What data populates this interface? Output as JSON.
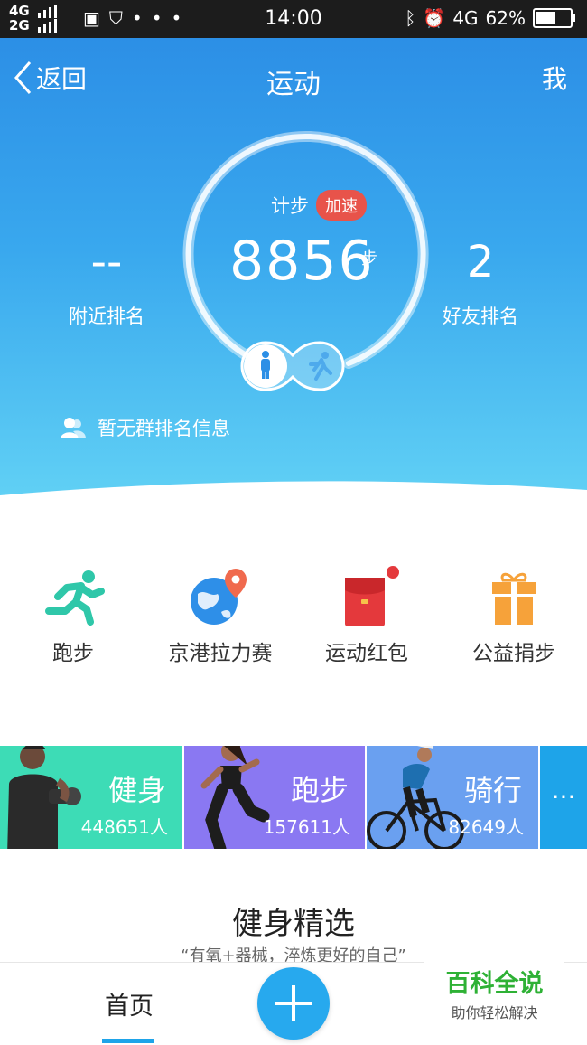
{
  "status_bar": {
    "network_top": "4G",
    "network_bottom": "2G",
    "time": "14:00",
    "network_right": "4G",
    "battery": "62%",
    "battery_level": 0.62
  },
  "nav": {
    "back_label": "返回",
    "title": "运动",
    "me_label": "我"
  },
  "stats": {
    "step_label": "计步",
    "accelerate_badge": "加速",
    "step_count": "8856",
    "step_unit": "步",
    "nearby_value": "--",
    "nearby_label": "附近排名",
    "friend_value": "2",
    "friend_label": "好友排名",
    "group_info": "暂无群排名信息"
  },
  "shortcuts": [
    {
      "label": "跑步",
      "icon": "running-icon"
    },
    {
      "label": "京港拉力赛",
      "icon": "globe-pin-icon"
    },
    {
      "label": "运动红包",
      "icon": "red-envelope-icon"
    },
    {
      "label": "公益捐步",
      "icon": "gift-icon"
    }
  ],
  "categories": [
    {
      "name": "健身",
      "count": "448651人",
      "color": "#3ddcb6"
    },
    {
      "name": "跑步",
      "count": "157611人",
      "color": "#8a78f2"
    },
    {
      "name": "骑行",
      "count": "82649人",
      "color": "#6aa0f0"
    }
  ],
  "more_label": "···",
  "section": {
    "title": "健身精选",
    "subtitle": "“有氧+器械，淬炼更好的自己”"
  },
  "tabbar": {
    "home_label": "首页"
  },
  "watermark": {
    "title": "百科全说",
    "subtitle": "助你轻松解决"
  },
  "colors": {
    "accent": "#1ea4e9",
    "badge_red": "#e8534a",
    "watermark_green": "#2eb135"
  }
}
